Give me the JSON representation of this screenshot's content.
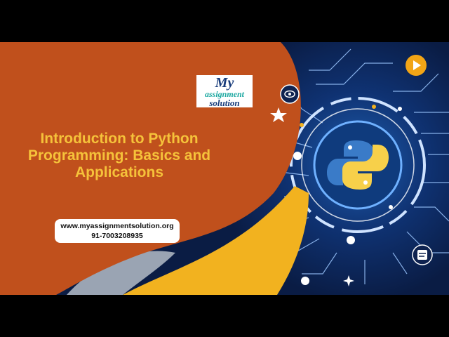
{
  "logo": {
    "line1": "My",
    "line2": "assignment",
    "line3": "solution"
  },
  "title": {
    "line1": "Introduction to Python",
    "line2": "Programming: Basics and",
    "line3": "Applications"
  },
  "contact": {
    "website": "www.myassignmentsolution.org",
    "phone": "91-7003208935"
  },
  "icons": [
    "python-logo-icon",
    "play-icon",
    "star-icon",
    "brain-icon",
    "document-icon",
    "sparkle-icon"
  ],
  "colors": {
    "orange": "#c0501c",
    "yellow": "#f2b21f",
    "navy": "#0b1f47",
    "title_text": "#f5c23a",
    "gray": "#9aa4b3"
  }
}
